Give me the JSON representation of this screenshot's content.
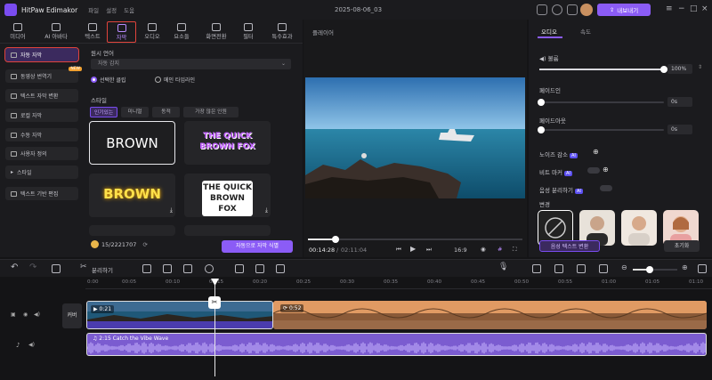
{
  "titlebar": {
    "app_name": "HitPaw Edimakor",
    "menus": [
      "파일",
      "설정",
      "도움"
    ],
    "document_name": "2025-08-06_03",
    "export_label": "내보내기"
  },
  "toolbar": {
    "tools": [
      {
        "label": "미디어",
        "icon": "media-icon"
      },
      {
        "label": "AI 아바타",
        "icon": "avatar-icon"
      },
      {
        "label": "텍스트",
        "icon": "text-icon"
      },
      {
        "label": "자막",
        "icon": "subtitle-icon",
        "active": true
      },
      {
        "label": "오디오",
        "icon": "music-icon"
      },
      {
        "label": "요소들",
        "icon": "elements-icon"
      },
      {
        "label": "화면전환",
        "icon": "transition-icon"
      },
      {
        "label": "필터",
        "icon": "filter-icon"
      },
      {
        "label": "특수효과",
        "icon": "effects-icon"
      }
    ]
  },
  "sidebar": {
    "items": [
      {
        "label": "자동 자막",
        "active": true
      },
      {
        "label": "동영상 번역기",
        "badge": "NEW"
      },
      {
        "label": "텍스트 자막 변환"
      },
      {
        "label": "로컬 자막"
      },
      {
        "label": "수동 자막"
      },
      {
        "label": "사용자 정의"
      },
      {
        "label": "스타일"
      },
      {
        "label": "텍스트 기반 편집"
      }
    ]
  },
  "subtitle_panel": {
    "source_language_label": "원시 언어",
    "language_value": "자동 감지",
    "radio_selected": "선택한 클립",
    "radio_other": "메인 타임라인",
    "style_label": "스타일",
    "style_tabs": [
      "인기있는",
      "미니멀",
      "동적",
      "가장 많은 인원"
    ],
    "style_samples": [
      "BROWN",
      "THE QUICK BROWN FOX",
      "BROWN",
      "THE QUICK BROWN FOX"
    ],
    "credits": "15/2221707",
    "generate_label": "자동으로 자막 식별"
  },
  "player": {
    "title": "플레이어",
    "current_time": "00:14:28",
    "total_time": "02:11:04",
    "aspect_ratio": "16:9",
    "progress": 0.13
  },
  "properties": {
    "tabs": [
      "오디오",
      "속도"
    ],
    "volume_label": "볼륨",
    "volume_value": "100%",
    "volume_level": 1.0,
    "fade_in_label": "페이드인",
    "fade_in_value": "0s",
    "fade_out_label": "페이드아웃",
    "fade_out_value": "0s",
    "noise_label": "노이즈 감소",
    "beat_label": "비트 마커",
    "voice_sep_label": "음성 분리하기",
    "ai_badge": "AI",
    "voice_change_label": "변경",
    "text_to_speech_label": "음성 텍스트 변환",
    "reset_label": "초기화"
  },
  "timeline_tools": {
    "split_label": "분리하기"
  },
  "timeline": {
    "ruler": [
      "0:00",
      "00:05",
      "00:10",
      "00:15",
      "00:20",
      "00:25",
      "00:30",
      "00:35",
      "00:40",
      "00:45",
      "00:50",
      "00:55",
      "01:00",
      "01:05",
      "01:10"
    ],
    "cover_label": "커버",
    "video_clip_duration": "0:21",
    "second_clip_duration": "0:52",
    "audio_clip_label": "2:15 Catch the Vibe Wave",
    "playhead_fraction": 0.25
  },
  "colors": {
    "accent": "#8b5cf6",
    "highlight": "#e0443c",
    "audio_track": "#7b5cd0",
    "video_track": "#5a4ac2"
  }
}
